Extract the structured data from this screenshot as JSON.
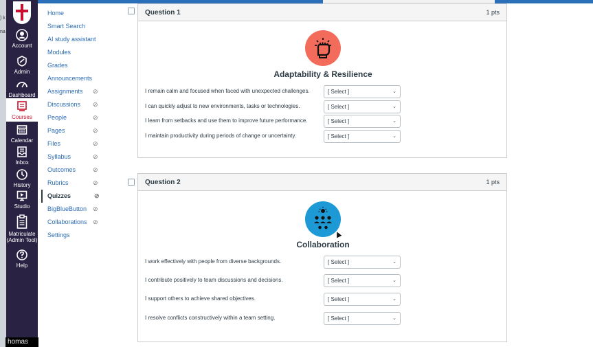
{
  "global_nav": [
    {
      "name": "account",
      "label": "Account",
      "icon": "account-icon"
    },
    {
      "name": "admin",
      "label": "Admin",
      "icon": "admin-icon"
    },
    {
      "name": "dashboard",
      "label": "Dashboard",
      "icon": "dashboard-icon"
    },
    {
      "name": "courses",
      "label": "Courses",
      "icon": "courses-icon",
      "active": true
    },
    {
      "name": "calendar",
      "label": "Calendar",
      "icon": "calendar-icon"
    },
    {
      "name": "inbox",
      "label": "Inbox",
      "icon": "inbox-icon"
    },
    {
      "name": "history",
      "label": "History",
      "icon": "history-icon"
    },
    {
      "name": "studio",
      "label": "Studio",
      "icon": "studio-icon"
    },
    {
      "name": "matriculate",
      "label": "Matriculate (Admin Tool)",
      "icon": "clipboard-icon"
    },
    {
      "name": "help",
      "label": "Help",
      "icon": "help-icon"
    }
  ],
  "course_nav": [
    {
      "label": "Home",
      "hidden": false
    },
    {
      "label": "Smart Search",
      "hidden": false
    },
    {
      "label": "AI study assistant",
      "hidden": false
    },
    {
      "label": "Modules",
      "hidden": false
    },
    {
      "label": "Grades",
      "hidden": false
    },
    {
      "label": "Announcements",
      "hidden": false
    },
    {
      "label": "Assignments",
      "hidden": true
    },
    {
      "label": "Discussions",
      "hidden": true
    },
    {
      "label": "People",
      "hidden": true
    },
    {
      "label": "Pages",
      "hidden": true
    },
    {
      "label": "Files",
      "hidden": true
    },
    {
      "label": "Syllabus",
      "hidden": true
    },
    {
      "label": "Outcomes",
      "hidden": true
    },
    {
      "label": "Rubrics",
      "hidden": true
    },
    {
      "label": "Quizzes",
      "hidden": true,
      "active": true
    },
    {
      "label": "BigBlueButton",
      "hidden": true
    },
    {
      "label": "Collaborations",
      "hidden": true
    },
    {
      "label": "Settings",
      "hidden": false
    }
  ],
  "left_window_bits": [
    ") k",
    "na"
  ],
  "bottom_name": "homas",
  "questions": [
    {
      "title": "Question 1",
      "points": "1 pts",
      "heading": "Adaptability & Resilience",
      "icon": "raised-fist-icon",
      "icon_color": "#f26b5b",
      "statements": [
        "I remain calm and focused when faced with unexpected challenges.",
        "I can quickly adjust to new environments, tasks or technologies.",
        "I learn from setbacks and use them to improve future performance.",
        "I maintain productivity during periods of change or uncertainty."
      ],
      "select_value": "[ Select ]"
    },
    {
      "title": "Question 2",
      "points": "1 pts",
      "heading": "Collaboration",
      "icon": "team-idea-icon",
      "icon_color": "#1d9ad6",
      "statements": [
        "I work effectively with people from diverse backgrounds.",
        "I contribute positively to team discussions and decisions.",
        "I support others to achieve shared objectives.",
        "I resolve conflicts constructively within a team setting."
      ],
      "select_value": "[ Select ]"
    }
  ],
  "colors": {
    "nav_bg": "#2a2243",
    "link": "#2d6db5",
    "brand_red": "#c8102e"
  }
}
